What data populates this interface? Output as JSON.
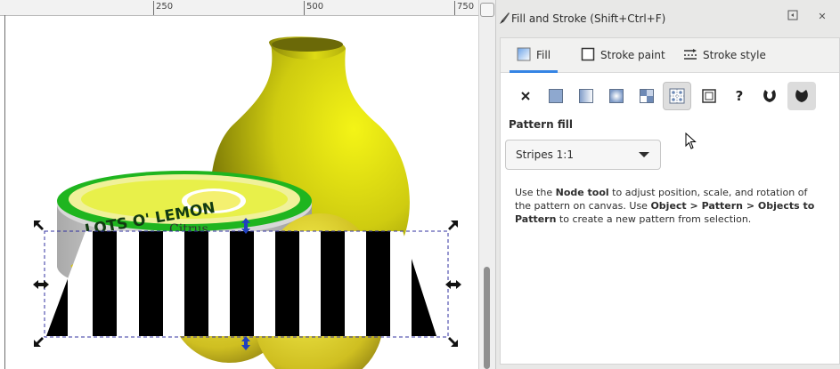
{
  "ruler": {
    "labels": [
      "250",
      "500",
      "750"
    ]
  },
  "panel": {
    "title": "Fill and Stroke (Shift+Ctrl+F)",
    "tabs": [
      {
        "label": "Fill"
      },
      {
        "label": "Stroke paint"
      },
      {
        "label": "Stroke style"
      }
    ],
    "fill_types": [
      "no-paint-icon",
      "flat-color-icon",
      "linear-gradient-icon",
      "radial-gradient-icon",
      "mesh-gradient-icon",
      "pattern-icon",
      "swatch-icon",
      "unset-paint-icon",
      "fill-rule-evenodd-icon",
      "fill-rule-nonzero-icon"
    ],
    "section_label": "Pattern fill",
    "pattern_selected": "Stripes 1:1",
    "help": {
      "p1": "Use the ",
      "b1": "Node tool",
      "p2": " to adjust position, scale, and rotation of the pattern on canvas. Use ",
      "b2": "Object > Pattern > Objects to Pattern",
      "p3": " to create a new pattern from selection."
    }
  },
  "colors": {
    "accent": "#3584e4",
    "lemon": "#e3e11a",
    "label_green": "#22b422"
  }
}
